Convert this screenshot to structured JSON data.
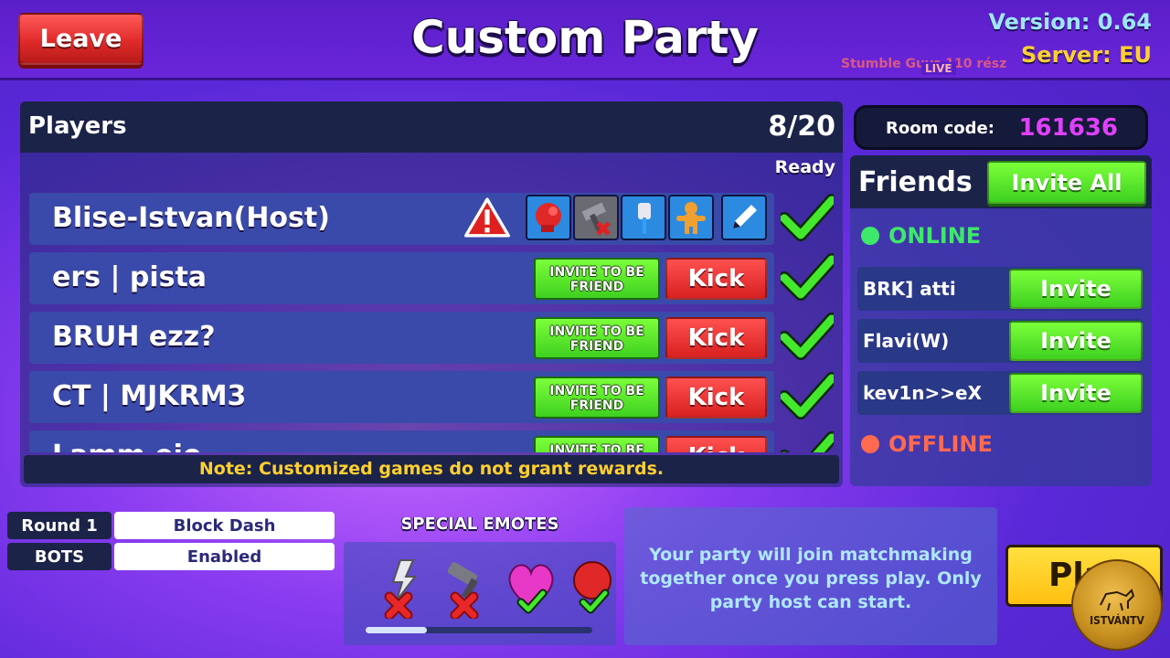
{
  "header": {
    "leave_label": "Leave",
    "title": "Custom Party",
    "version": "Version: 0.64",
    "server": "Server: EU",
    "stream_tag": "Stumble Guys 110 rész",
    "live_label": "LIVE"
  },
  "players": {
    "title": "Players",
    "count": "8/20",
    "ready_label": "Ready",
    "invite_label": "INVITE TO BE FRIEND",
    "kick_label": "Kick",
    "list": [
      {
        "name": "Blise-Istvan(Host)",
        "ready": true
      },
      {
        "name": "ers | pista",
        "ready": true
      },
      {
        "name": "BRUH ezz?",
        "ready": true
      },
      {
        "name": "CT | MJKRM3",
        "ready": true
      },
      {
        "name": "Lamm ejo",
        "ready": true
      }
    ],
    "note": "Note: Customized games do not grant rewards."
  },
  "room": {
    "label": "Room code:",
    "code": "161636"
  },
  "friends": {
    "title": "Friends",
    "invite_all_label": "Invite All",
    "online_label": "ONLINE",
    "offline_label": "OFFLINE",
    "invite_label": "Invite",
    "online": [
      "BRK] atti",
      "Flavi(W)",
      "kev1n>>eX"
    ]
  },
  "settings": {
    "round_label": "Round 1",
    "round_value": "Block Dash",
    "bots_label": "BOTS",
    "bots_value": "Enabled"
  },
  "emotes": {
    "title": "SPECIAL EMOTES",
    "scroll_fraction": 0.27
  },
  "info": {
    "message": "Your party will join matchmaking together once you press play. Only party host can start."
  },
  "play_label": "Play",
  "logo_text": "ISTVÁNTV",
  "colors": {
    "accent_green": "#3ed020",
    "accent_red": "#e02a2a",
    "room_code": "#e040ff",
    "note_yellow": "#ffd030",
    "online_dot": "#3ee86a",
    "offline_dot": "#ff6a50"
  }
}
